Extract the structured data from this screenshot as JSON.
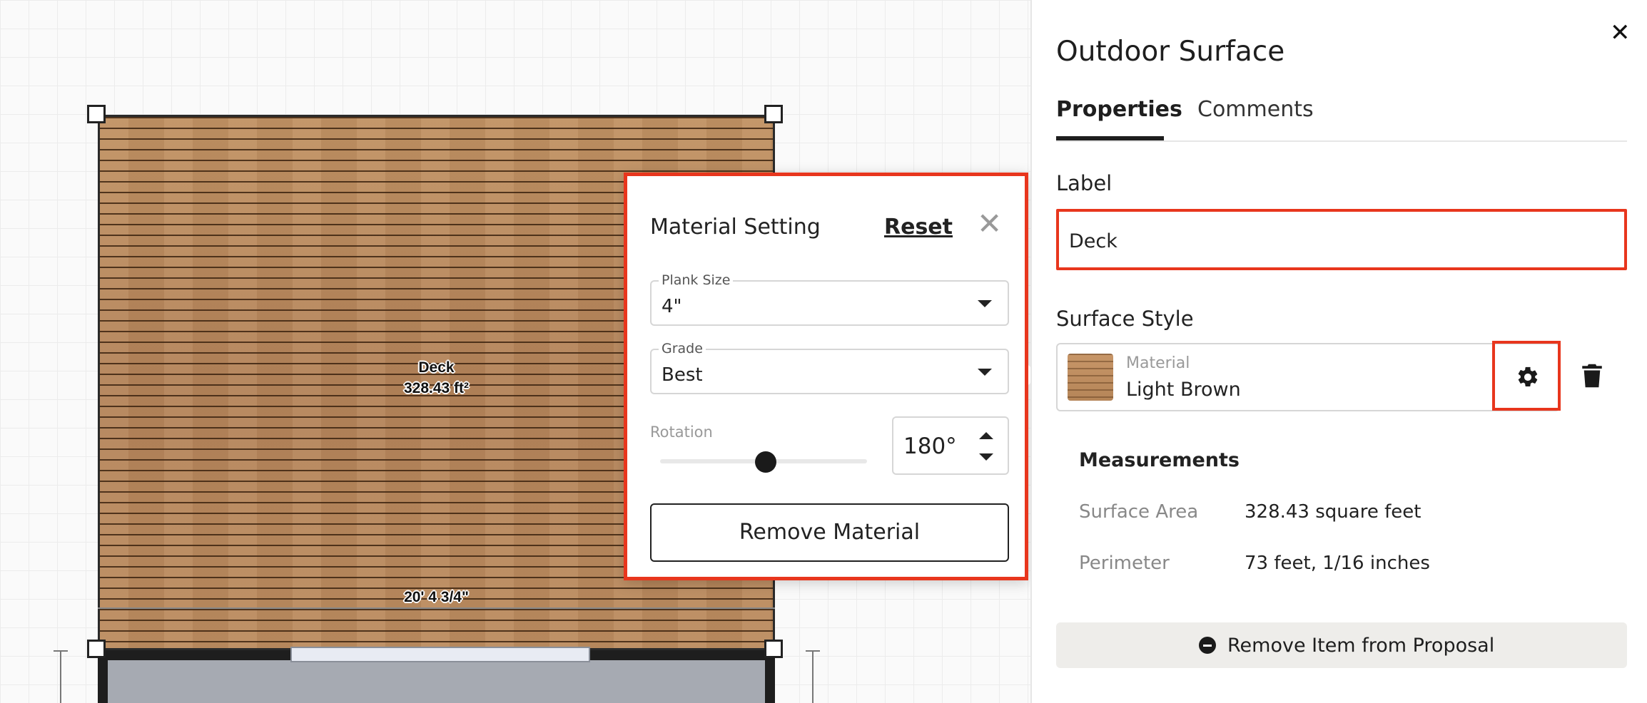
{
  "canvas": {
    "deck_name": "Deck",
    "deck_area": "328.43 ft²",
    "deck_dimension": "20' 4 3/4\""
  },
  "popup": {
    "title": "Material Setting",
    "reset_label": "Reset",
    "close_glyph": "✕",
    "plank_size": {
      "label": "Plank Size",
      "value": "4\""
    },
    "grade": {
      "label": "Grade",
      "value": "Best"
    },
    "rotation": {
      "label": "Rotation",
      "value": "180°",
      "slider_fraction": 0.5
    },
    "remove_material_label": "Remove Material"
  },
  "panel": {
    "close_glyph": "✕",
    "title": "Outdoor Surface",
    "tabs": [
      {
        "label": "Properties",
        "active": true
      },
      {
        "label": "Comments",
        "active": false
      }
    ],
    "label_section": {
      "heading": "Label",
      "value": "Deck"
    },
    "surface_style": {
      "heading": "Surface Style",
      "material_label": "Material",
      "material_value": "Light Brown"
    },
    "measurements": {
      "heading": "Measurements",
      "rows": [
        {
          "key": "Surface Area",
          "value": "328.43 square feet"
        },
        {
          "key": "Perimeter",
          "value": "73 feet, 1/16 inches"
        }
      ]
    },
    "remove_item_label": "Remove Item from Proposal"
  },
  "icons": {
    "gear": "gear-icon",
    "trash": "trash-icon",
    "minus_circle": "minus-circle-icon",
    "close": "close-icon"
  },
  "colors": {
    "highlight": "#e8361d",
    "deck_wood": "#b98a5e"
  }
}
